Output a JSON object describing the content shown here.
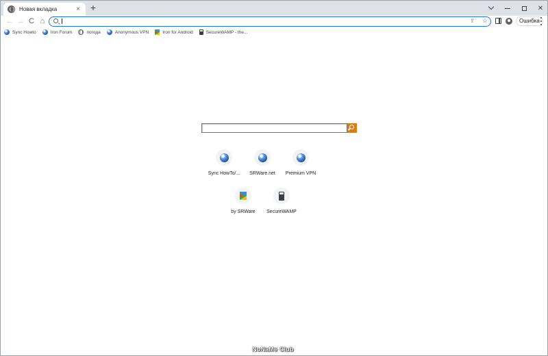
{
  "tab": {
    "title": "Новая вкладка",
    "close_glyph": "×",
    "new_tab_glyph": "+"
  },
  "toolbar": {
    "back_glyph": "←",
    "forward_glyph": "→",
    "reload_glyph": "C",
    "home_glyph": "⌂",
    "omnibox_value": "",
    "share_glyph": "⇪",
    "star_glyph": "☆",
    "error_chip_label": "Ошибка"
  },
  "bookmarks": [
    {
      "label": "Sync Howto",
      "icon": "srware-globe-icon"
    },
    {
      "label": "Iron Forum",
      "icon": "srware-globe-icon"
    },
    {
      "label": "погода",
      "icon": "globe-icon"
    },
    {
      "label": "Anonymous VPN",
      "icon": "srware-globe-icon"
    },
    {
      "label": "Iron for Android",
      "icon": "play-store-icon"
    },
    {
      "label": "SecureWAMP - the...",
      "icon": "securewamp-icon"
    }
  ],
  "search": {
    "value": "",
    "accent_color": "#e07c0e"
  },
  "shortcuts": [
    {
      "label": "Sync HowTo/...",
      "icon": "srware-globe-icon"
    },
    {
      "label": "SRWare.net",
      "icon": "srware-globe-icon"
    },
    {
      "label": "Premium VPN",
      "icon": "srware-globe-icon"
    },
    {
      "label": "by SRWare",
      "icon": "play-store-icon"
    },
    {
      "label": "SecureWAMP",
      "icon": "securewamp-icon"
    }
  ],
  "watermark": "NoNaMe Club",
  "colors": {
    "omnibox_focus": "#1a73e8",
    "tabstrip": "#dee1e6"
  }
}
